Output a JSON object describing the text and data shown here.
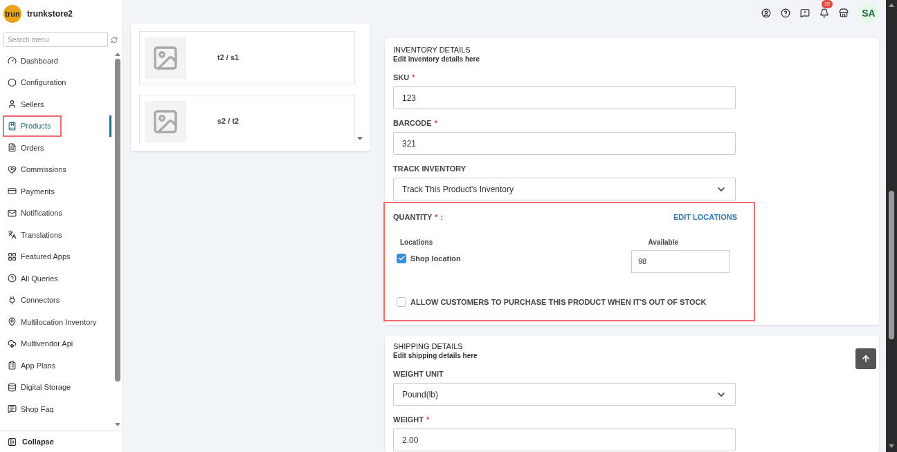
{
  "sidebar": {
    "store_logo": "trun",
    "store_name": "trunkstore2",
    "search": {
      "placeholder": "Search menu"
    },
    "items": [
      {
        "label": "Dashboard",
        "selected": false,
        "highlighted": false
      },
      {
        "label": "Configuration",
        "selected": false,
        "highlighted": false
      },
      {
        "label": "Sellers",
        "selected": false,
        "highlighted": false
      },
      {
        "label": "Products",
        "selected": true,
        "highlighted": true
      },
      {
        "label": "Orders",
        "selected": false,
        "highlighted": false
      },
      {
        "label": "Commissions",
        "selected": false,
        "highlighted": false
      },
      {
        "label": "Payments",
        "selected": false,
        "highlighted": false
      },
      {
        "label": "Notifications",
        "selected": false,
        "highlighted": false
      },
      {
        "label": "Translations",
        "selected": false,
        "highlighted": false
      },
      {
        "label": "Featured Apps",
        "selected": false,
        "highlighted": false
      },
      {
        "label": "All Queries",
        "selected": false,
        "highlighted": false
      },
      {
        "label": "Connectors",
        "selected": false,
        "highlighted": false
      },
      {
        "label": "Multilocation Inventory",
        "selected": false,
        "highlighted": false
      },
      {
        "label": "Multivendor Api",
        "selected": false,
        "highlighted": false
      },
      {
        "label": "App Plans",
        "selected": false,
        "highlighted": false
      },
      {
        "label": "Digital Storage",
        "selected": false,
        "highlighted": false
      },
      {
        "label": "Shop Faq",
        "selected": false,
        "highlighted": false
      }
    ],
    "collapse": "Collapse"
  },
  "header": {
    "notification_count": "15",
    "avatar": "SA"
  },
  "variants": [
    {
      "title": "t2 / s1"
    },
    {
      "title": "s2 / t2"
    }
  ],
  "inventory": {
    "title": "INVENTORY DETAILS",
    "subtitle": "Edit inventory details here",
    "fields": [
      {
        "kind": "input",
        "label": "SKU",
        "required_mark": "*",
        "value": "123"
      },
      {
        "kind": "input",
        "label": "BARCODE",
        "required_mark": "*",
        "value": "321"
      },
      {
        "kind": "select",
        "label": "TRACK INVENTORY",
        "value": "Track This Product's Inventory"
      }
    ],
    "quantity": {
      "label": "QUANTITY",
      "required_mark": "*",
      "suffix": ":",
      "highlighted": true,
      "edit_link": "EDIT LOCATIONS",
      "columns": [
        "Locations",
        "Available"
      ],
      "locations": [
        {
          "name": "Shop location",
          "checked": true,
          "available": "98"
        }
      ],
      "allow_oos": {
        "label": "ALLOW CUSTOMERS TO PURCHASE THIS PRODUCT WHEN IT'S OUT OF STOCK",
        "checked": false
      }
    }
  },
  "shipping": {
    "title": "SHIPPING DETAILS",
    "subtitle": "Edit shipping details here",
    "fields": [
      {
        "kind": "select",
        "label": "WEIGHT UNIT",
        "value": "Pound(lb)"
      },
      {
        "kind": "input",
        "label": "WEIGHT",
        "required_mark": "*",
        "value": "2.00"
      }
    ]
  }
}
